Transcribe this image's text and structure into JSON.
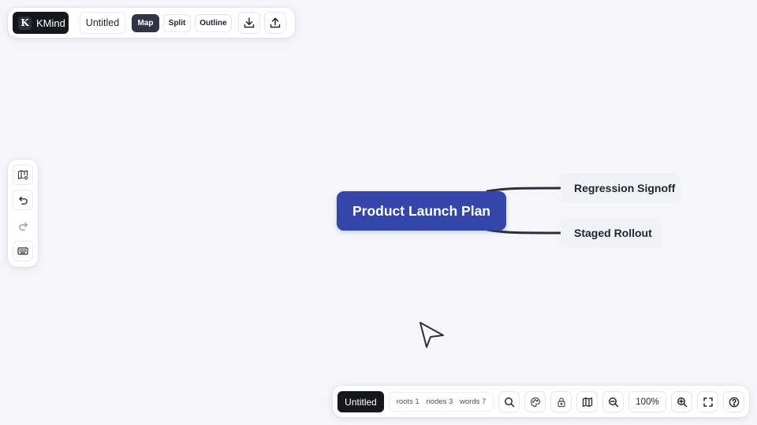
{
  "app": {
    "name": "KMind",
    "logo_letter": "K"
  },
  "top_toolbar": {
    "doc_title": "Untitled",
    "views": [
      {
        "label": "Map",
        "active": true
      },
      {
        "label": "Split",
        "active": false
      },
      {
        "label": "Outline",
        "active": false
      }
    ],
    "icons": [
      "download-icon",
      "upload-icon"
    ]
  },
  "left_toolbar": {
    "icons": [
      "map-settings-icon",
      "undo-icon",
      "redo-icon",
      "keyboard-icon"
    ]
  },
  "mindmap": {
    "root": "Product Launch Plan",
    "children": [
      "Regression Signoff",
      "Staged Rollout"
    ],
    "colors": {
      "root_fill": "#3546ab",
      "child_fill": "#f1f2f6",
      "edge": "#2b2f3a"
    }
  },
  "bottom_bar": {
    "doc_title": "Untitled",
    "stats": {
      "roots": "roots 1",
      "nodes": "nodes 3",
      "words": "words 7"
    },
    "zoom": "100%",
    "icons": [
      "search-icon",
      "theme-icon",
      "lock-icon",
      "map-icon",
      "zoom-out-icon",
      "zoom-in-icon",
      "fullscreen-icon",
      "help-icon"
    ]
  }
}
